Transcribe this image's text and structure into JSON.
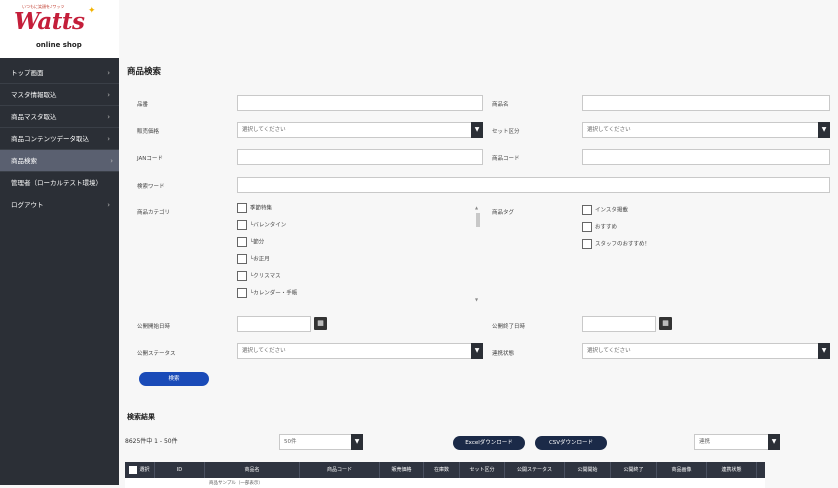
{
  "brand": {
    "tagline": "いつもに笑顔を♪ワッツ",
    "logo": "Watts",
    "sub": "online shop"
  },
  "nav": [
    {
      "label": "トップ画面"
    },
    {
      "label": "マスタ情報取込"
    },
    {
      "label": "商品マスタ取込"
    },
    {
      "label": "商品コンテンツデータ取込"
    },
    {
      "label": "商品検索"
    },
    {
      "label": "管理者（ローカルテスト環境）"
    },
    {
      "label": "ログアウト"
    }
  ],
  "page_title": "商品検索",
  "form": {
    "hinban": "品番",
    "shohinmei": "商品名",
    "hanbai_kakaku": "販売価格",
    "set_kubun": "セット区分",
    "jan": "JANコード",
    "shohin_code": "商品コード",
    "keyword": "検索ワード",
    "category": "商品カテゴリ",
    "tag": "商品タグ",
    "start_date": "公開開始日時",
    "end_date": "公開終了日時",
    "status": "公開ステータス",
    "renkei": "連携状態",
    "placeholder_select": "選択してください",
    "search_btn": "検索"
  },
  "categories": [
    "季節特集",
    "└バレンタイン",
    "└節分",
    "└お正月",
    "└クリスマス",
    "└カレンダー・手帳"
  ],
  "tags": [
    "インスタ掲載",
    "おすすめ",
    "スタッフのおすすめ！"
  ],
  "results": {
    "title": "検索結果",
    "count": "8625件中 1 - 50件",
    "per_page": "50件",
    "excel_btn": "Excelダウンロード",
    "csv_btn": "CSVダウンロード",
    "action": "連携"
  },
  "table": {
    "headers": [
      "選択",
      "ID",
      "商品名",
      "商品コード",
      "販売価格",
      "在庫数",
      "セット区分",
      "公開ステータス",
      "公開開始",
      "公開終了",
      "商品画像",
      "連携状態"
    ],
    "first_row_name": "商品サンプル（一部表示）"
  }
}
